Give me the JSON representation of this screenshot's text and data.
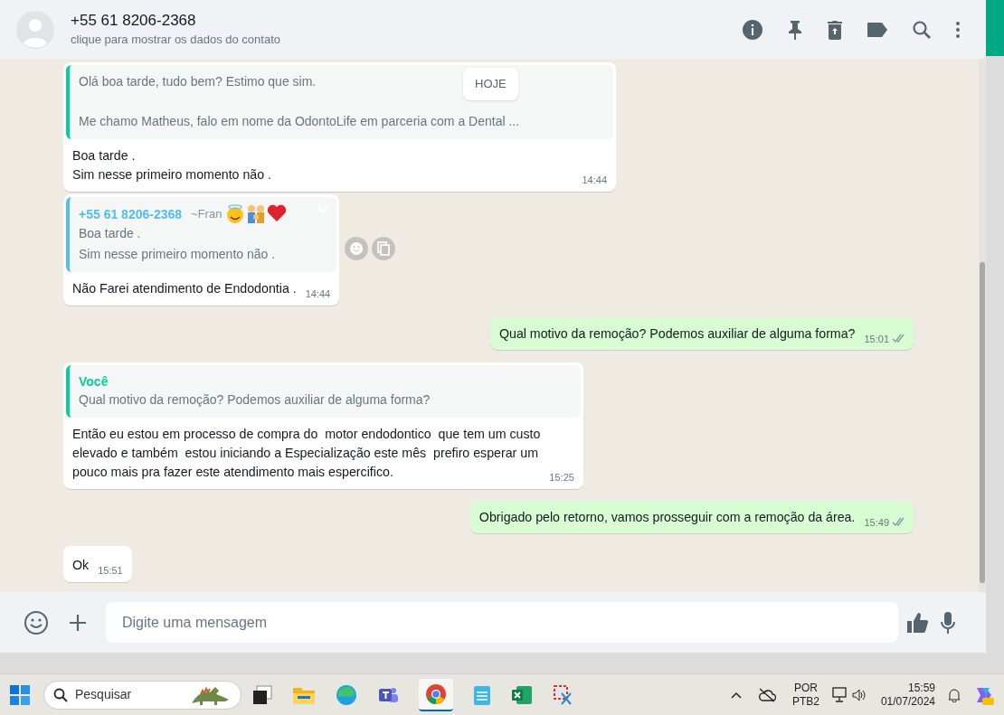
{
  "header": {
    "title": "+55 61 8206-2368",
    "subtitle": "clique para mostrar os dados do contato"
  },
  "date_chip": "HOJE",
  "messages": [
    {
      "kind": "in",
      "hovered": false,
      "quote": {
        "color": "#06cf9c",
        "paragraphs": [
          "Olá boa tarde, tudo bem? Estimo que sim.",
          "Me chamo Matheus, falo em nome da OdontoLife em parceria com a Dental ..."
        ]
      },
      "lines": [
        "Boa tarde .",
        "Sim nesse primeiro momento não ."
      ],
      "time": "14:44"
    },
    {
      "kind": "in",
      "hovered": true,
      "quote": {
        "color": "#53bdeb",
        "author": "+55 61 8206-2368",
        "author_note": "~Fran",
        "paragraphs": [
          "Boa tarde .",
          "Sim nesse primeiro momento não ."
        ]
      },
      "lines": [
        "Não Farei atendimento de Endodontia ."
      ],
      "time": "14:44"
    },
    {
      "kind": "out",
      "read": false,
      "lines": [
        "Qual motivo da remoção? Podemos auxiliar de alguma forma?"
      ],
      "time": "15:01"
    },
    {
      "kind": "in",
      "hovered": false,
      "quote": {
        "color": "#06cf9c",
        "author": "Você",
        "paragraphs": [
          "Qual motivo da remoção? Podemos auxiliar de alguma forma?"
        ]
      },
      "lines": [
        "Então eu estou em processo de compra do  motor endodontico  que tem um custo",
        "elevado e também  estou iniciando a Especialização este mês  prefiro esperar um",
        "pouco mais pra fazer este atendimento mais espercifico."
      ],
      "time": "15:25"
    },
    {
      "kind": "out",
      "read": false,
      "lines": [
        "Obrigado pelo retorno, vamos prosseguir com a remoção da área."
      ],
      "time": "15:49"
    },
    {
      "kind": "in",
      "hovered": false,
      "lines": [
        "Ok"
      ],
      "time": "15:51"
    }
  ],
  "composer": {
    "placeholder": "Digite uma mensagem"
  },
  "taskbar": {
    "search_placeholder": "Pesquisar",
    "language": "POR",
    "layout": "PTB2",
    "time": "15:59",
    "date": "01/07/2024"
  }
}
